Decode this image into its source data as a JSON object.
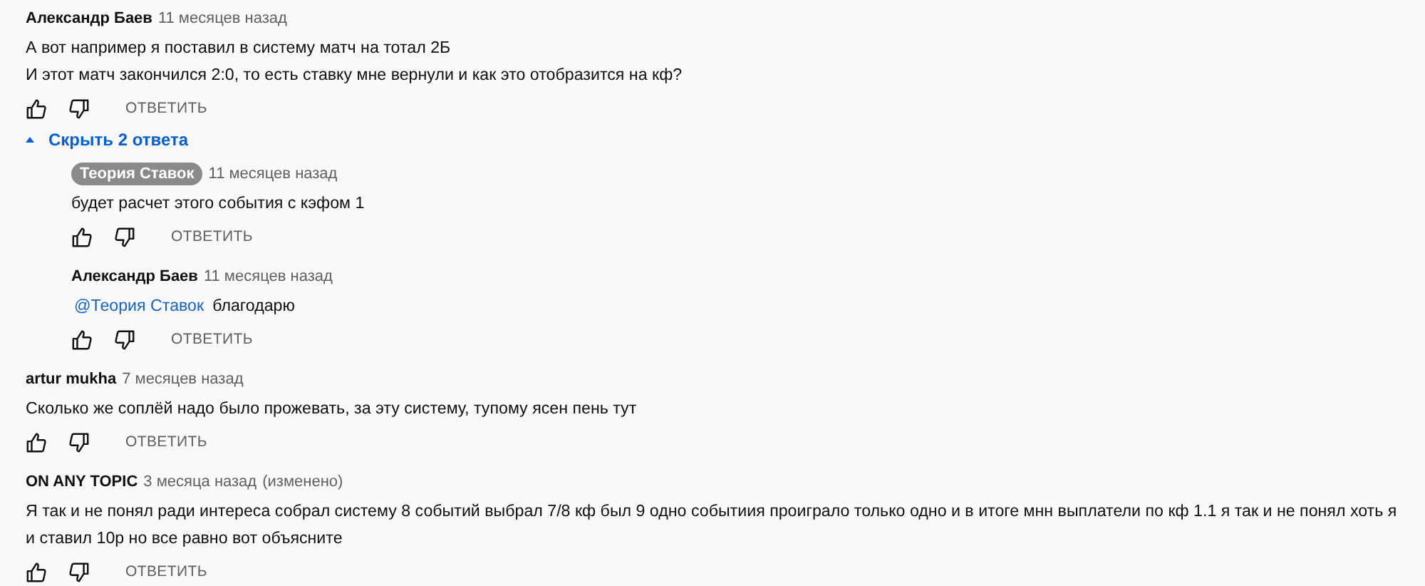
{
  "comments": [
    {
      "author": "Александр Баев",
      "owner": false,
      "time": "11 месяцев назад",
      "lines": [
        "А вот например я поставил в систему матч на тотал 2Б",
        "И этот матч закончился 2:0, то есть ставку мне вернули и как это отобразится на кф?"
      ],
      "reply_label": "ОТВЕТИТЬ",
      "replies_toggle": {
        "label": "Скрыть 2 ответа",
        "expanded": true
      },
      "replies": [
        {
          "author": "Теория Ставок",
          "owner": true,
          "time": "11 месяцев назад",
          "lines": [
            "будет расчет этого события с кэфом 1"
          ],
          "reply_label": "ОТВЕТИТЬ"
        },
        {
          "author": "Александр Баев",
          "owner": false,
          "time": "11 месяцев назад",
          "mention": "@Теория Ставок",
          "lines": [
            "благодарю"
          ],
          "reply_label": "ОТВЕТИТЬ"
        }
      ]
    },
    {
      "author": "artur mukha",
      "owner": false,
      "time": "7 месяцев назад",
      "lines": [
        "Сколько же соплёй надо было прожевать, за эту систему, тупому ясен пень тут"
      ],
      "reply_label": "ОТВЕТИТЬ"
    },
    {
      "author": "ON ANY TOPIC",
      "owner": false,
      "time": "3 месяца назад",
      "edited": "(изменено)",
      "lines": [
        "Я так и не понял ради интереса собрал систему 8 событий выбрал 7/8 кф был 9 одно событиия проиграло только одно и в итоге мнн выплатели по кф 1.1 я так и не понял хоть я",
        "и ставил 10р но все равно вот объясните"
      ],
      "reply_label": "ОТВЕТИТЬ"
    }
  ]
}
